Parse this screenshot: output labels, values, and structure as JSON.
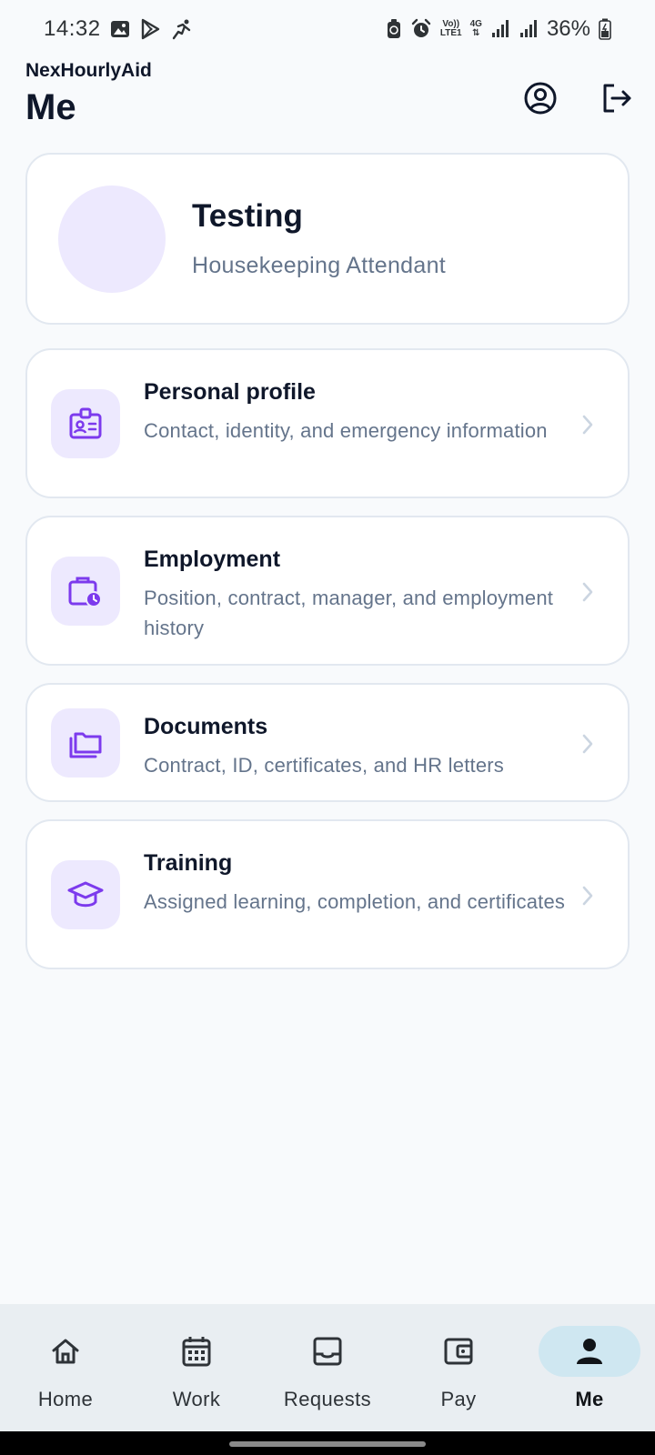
{
  "status_bar": {
    "time": "14:32",
    "network_top": "Vo))",
    "network_bottom": "LTE1",
    "network_gen": "4G",
    "battery": "36%"
  },
  "header": {
    "app_name": "NexHourlyAid",
    "title": "Me"
  },
  "profile": {
    "name": "Testing",
    "role": "Housekeeping Attendant"
  },
  "menu": [
    {
      "title": "Personal profile",
      "subtitle": "Contact, identity, and emergency information",
      "icon": "id-badge-icon"
    },
    {
      "title": "Employment",
      "subtitle": "Position, contract, manager, and employment history",
      "icon": "briefcase-clock-icon"
    },
    {
      "title": "Documents",
      "subtitle": "Contract, ID, certificates, and HR letters",
      "icon": "folders-icon"
    },
    {
      "title": "Training",
      "subtitle": "Assigned learning, completion, and certificates",
      "icon": "graduation-cap-icon"
    }
  ],
  "nav": [
    {
      "label": "Home",
      "icon": "home-icon"
    },
    {
      "label": "Work",
      "icon": "calendar-icon"
    },
    {
      "label": "Requests",
      "icon": "inbox-icon"
    },
    {
      "label": "Pay",
      "icon": "wallet-icon"
    },
    {
      "label": "Me",
      "icon": "person-icon",
      "active": true
    }
  ],
  "colors": {
    "accent": "#7c3aed",
    "icon_bg": "#ede9fe",
    "nav_active_bg": "#cfe7f1",
    "background": "#f8fafc"
  }
}
